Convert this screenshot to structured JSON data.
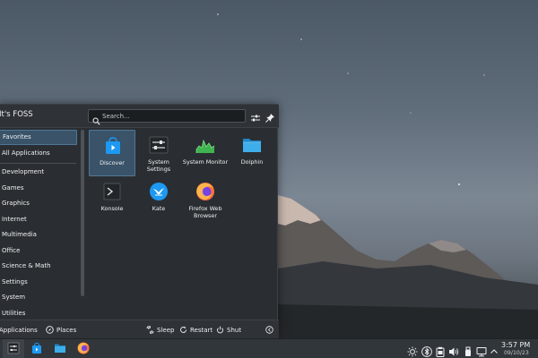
{
  "launcher": {
    "user_name": "It's FOSS",
    "search_placeholder": "Search...",
    "sidebar_items": [
      {
        "label": "Favorites"
      },
      {
        "label": "All Applications"
      },
      {
        "label": "Development"
      },
      {
        "label": "Games"
      },
      {
        "label": "Graphics"
      },
      {
        "label": "Internet"
      },
      {
        "label": "Multimedia"
      },
      {
        "label": "Office"
      },
      {
        "label": "Science & Math"
      },
      {
        "label": "Settings"
      },
      {
        "label": "System"
      },
      {
        "label": "Utilities"
      }
    ],
    "selected_category": "Favorites",
    "apps": [
      {
        "label": "Discover",
        "icon": "discover-icon"
      },
      {
        "label": "System Settings",
        "icon": "system-settings-icon"
      },
      {
        "label": "System Monitor",
        "icon": "system-monitor-icon"
      },
      {
        "label": "Dolphin",
        "icon": "dolphin-folder-icon"
      },
      {
        "label": "Konsole",
        "icon": "konsole-terminal-icon"
      },
      {
        "label": "Kate",
        "icon": "kate-editor-icon"
      },
      {
        "label": "Firefox Web Browser",
        "icon": "firefox-icon"
      }
    ],
    "footer": {
      "applications_label": "Applications",
      "places_label": "Places",
      "sleep_label": "Sleep",
      "restart_label": "Restart",
      "shutdown_label": "Shut Down"
    }
  },
  "taskbar": {
    "clock_time": "3:57 PM",
    "clock_date": "09/10/23"
  },
  "colors": {
    "accent": "#3daee9",
    "selection": "#3a5368",
    "panel": "#2a2e32",
    "taskbar": "#31363b"
  }
}
